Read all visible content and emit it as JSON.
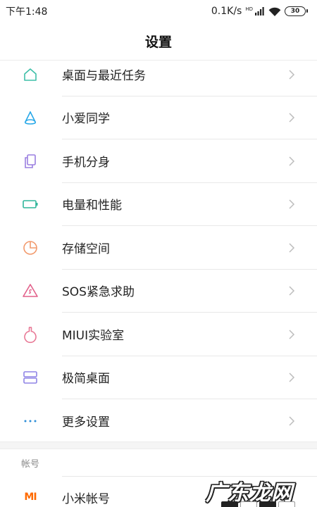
{
  "status_bar": {
    "time": "下午1:48",
    "network_speed": "0.1K/s",
    "hd_label": "HD",
    "battery_level": "30"
  },
  "header": {
    "title": "设置"
  },
  "settings_items": [
    {
      "label": "桌面与最近任务",
      "icon": "home-icon"
    },
    {
      "label": "小爱同学",
      "icon": "xiaoai-icon"
    },
    {
      "label": "手机分身",
      "icon": "clone-icon"
    },
    {
      "label": "电量和性能",
      "icon": "battery-icon"
    },
    {
      "label": "存储空间",
      "icon": "pie-chart-icon"
    },
    {
      "label": "SOS紧急求助",
      "icon": "sos-icon"
    },
    {
      "label": "MIUI实验室",
      "icon": "flask-icon"
    },
    {
      "label": "极简桌面",
      "icon": "simple-desktop-icon"
    },
    {
      "label": "更多设置",
      "icon": "more-dots-icon"
    }
  ],
  "account_section": {
    "header": "帐号",
    "items": [
      {
        "label": "小米帐号",
        "icon_text": "MI"
      }
    ]
  },
  "watermark": {
    "text": "广东龙网"
  },
  "colors": {
    "home": "#3fbfa8",
    "xiaoai": "#28a8e8",
    "clone": "#9a7ee0",
    "battery": "#2fb59a",
    "storage": "#f29a6d",
    "sos": "#e2608a",
    "flask": "#e87895",
    "simple": "#8f84e6",
    "more": "#2f8fd8",
    "mi": "#ff6a00"
  }
}
